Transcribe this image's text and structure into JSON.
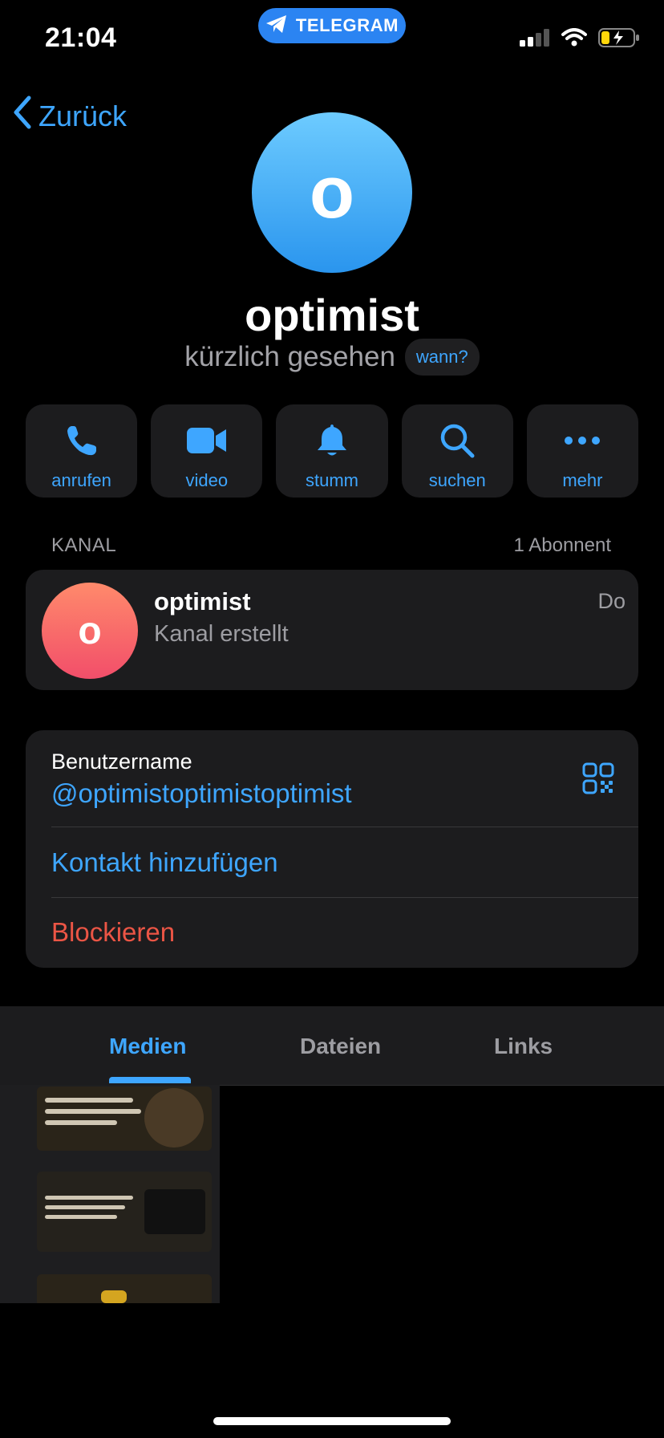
{
  "status_bar": {
    "time": "21:04",
    "pill_label": "TELEGRAM"
  },
  "nav": {
    "back_label": "Zurück"
  },
  "profile": {
    "avatar_letter": "o",
    "name": "optimist",
    "presence": "kürzlich gesehen",
    "when_chip": "wann?"
  },
  "actions": [
    {
      "label": "anrufen",
      "icon": "phone-icon"
    },
    {
      "label": "video",
      "icon": "video-camera-icon"
    },
    {
      "label": "stumm",
      "icon": "bell-icon"
    },
    {
      "label": "suchen",
      "icon": "search-icon"
    },
    {
      "label": "mehr",
      "icon": "more-icon"
    }
  ],
  "channel_section": {
    "header": "KANAL",
    "subscribers": "1 Abonnent",
    "item": {
      "avatar_letter": "o",
      "title": "optimist",
      "subtitle": "Kanal erstellt",
      "date": "Do"
    }
  },
  "info": {
    "username_label": "Benutzername",
    "username": "@optimistoptimistoptimist",
    "add_contact": "Kontakt hinzufügen",
    "block": "Blockieren"
  },
  "tabs": [
    {
      "label": "Medien",
      "active": true
    },
    {
      "label": "Dateien",
      "active": false
    },
    {
      "label": "Links",
      "active": false
    }
  ],
  "colors": {
    "accent": "#3ea6ff",
    "danger": "#eb5545",
    "card": "#1c1c1e",
    "secondary_text": "#9d9da2"
  }
}
